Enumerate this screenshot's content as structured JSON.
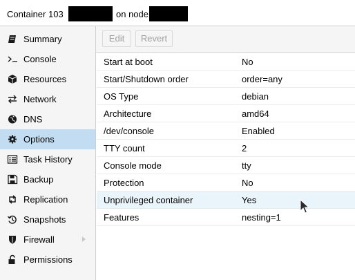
{
  "header": {
    "title_prefix": "Container 103",
    "title_middle": "on node"
  },
  "sidebar": {
    "items": [
      {
        "label": "Summary",
        "icon": "book-icon",
        "active": false
      },
      {
        "label": "Console",
        "icon": "terminal-icon",
        "active": false
      },
      {
        "label": "Resources",
        "icon": "cube-icon",
        "active": false
      },
      {
        "label": "Network",
        "icon": "exchange-icon",
        "active": false
      },
      {
        "label": "DNS",
        "icon": "globe-icon",
        "active": false
      },
      {
        "label": "Options",
        "icon": "gear-icon",
        "active": true
      },
      {
        "label": "Task History",
        "icon": "list-icon",
        "active": false
      },
      {
        "label": "Backup",
        "icon": "floppy-icon",
        "active": false
      },
      {
        "label": "Replication",
        "icon": "retweet-icon",
        "active": false
      },
      {
        "label": "Snapshots",
        "icon": "history-icon",
        "active": false
      },
      {
        "label": "Firewall",
        "icon": "shield-icon",
        "active": false,
        "expandable": true
      },
      {
        "label": "Permissions",
        "icon": "unlock-icon",
        "active": false
      }
    ]
  },
  "toolbar": {
    "edit_label": "Edit",
    "revert_label": "Revert"
  },
  "options": {
    "rows": [
      {
        "key": "Start at boot",
        "value": "No"
      },
      {
        "key": "Start/Shutdown order",
        "value": "order=any"
      },
      {
        "key": "OS Type",
        "value": "debian"
      },
      {
        "key": "Architecture",
        "value": "amd64"
      },
      {
        "key": "/dev/console",
        "value": "Enabled"
      },
      {
        "key": "TTY count",
        "value": "2"
      },
      {
        "key": "Console mode",
        "value": "tty"
      },
      {
        "key": "Protection",
        "value": "No"
      },
      {
        "key": "Unprivileged container",
        "value": "Yes"
      },
      {
        "key": "Features",
        "value": "nesting=1"
      }
    ]
  },
  "colors": {
    "active_nav": "#c2ddf2",
    "hover_row": "#eaf4fb",
    "sidebar_bg": "#f5f5f5"
  }
}
